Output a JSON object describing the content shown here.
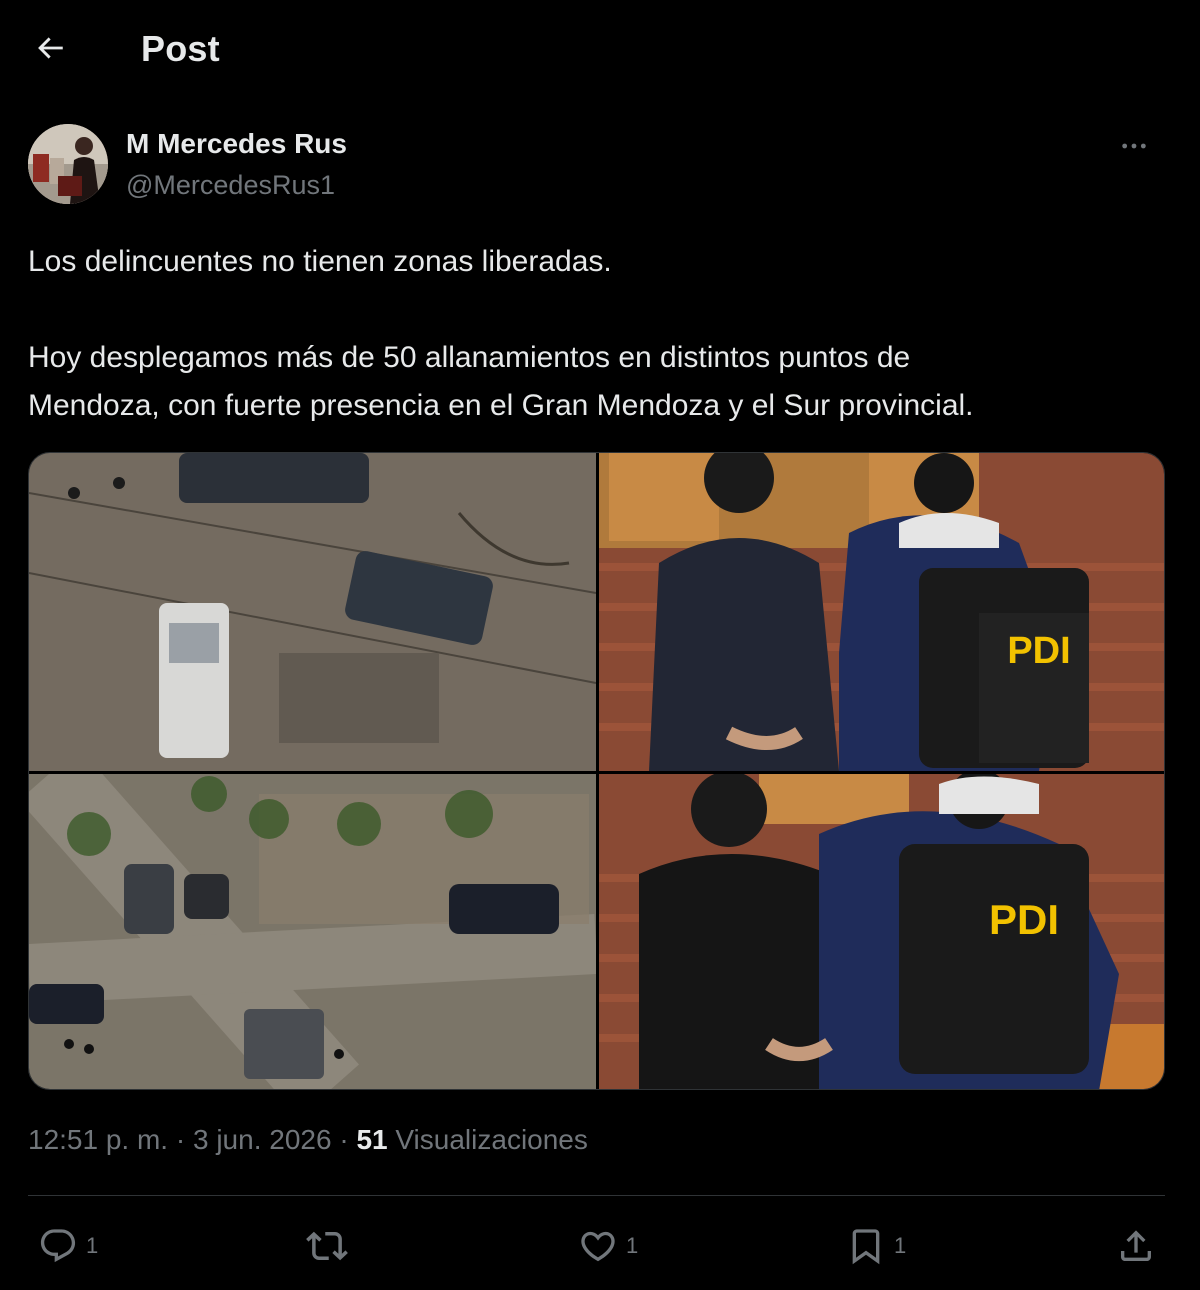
{
  "header": {
    "title": "Post",
    "back_icon": "arrow-left-icon"
  },
  "author": {
    "name": "M Mercedes Rus",
    "handle": "@MercedesRus1"
  },
  "tweet": {
    "paragraph1": "Los delincuentes no tienen zonas liberadas.",
    "paragraph2_line1": "Hoy desplegamos más de 50 allanamientos en distintos puntos de",
    "paragraph2_line2": "Mendoza, con fuerte presencia en el Gran Mendoza y el Sur provincial."
  },
  "media": {
    "vest_label_1": "PDI",
    "vest_label_2": "PDI"
  },
  "meta": {
    "time": "12:51 p. m.",
    "separator1": " · ",
    "date": "3 jun. 2026",
    "separator2": " · ",
    "views_count": "51",
    "views_label": " Visualizaciones"
  },
  "actions": {
    "reply_count": "1",
    "repost_count": "",
    "like_count": "1",
    "bookmark_count": "1"
  },
  "colors": {
    "background": "#000000",
    "text_primary": "#e7e9ea",
    "text_secondary": "#71767b",
    "divider": "#2f3336"
  }
}
